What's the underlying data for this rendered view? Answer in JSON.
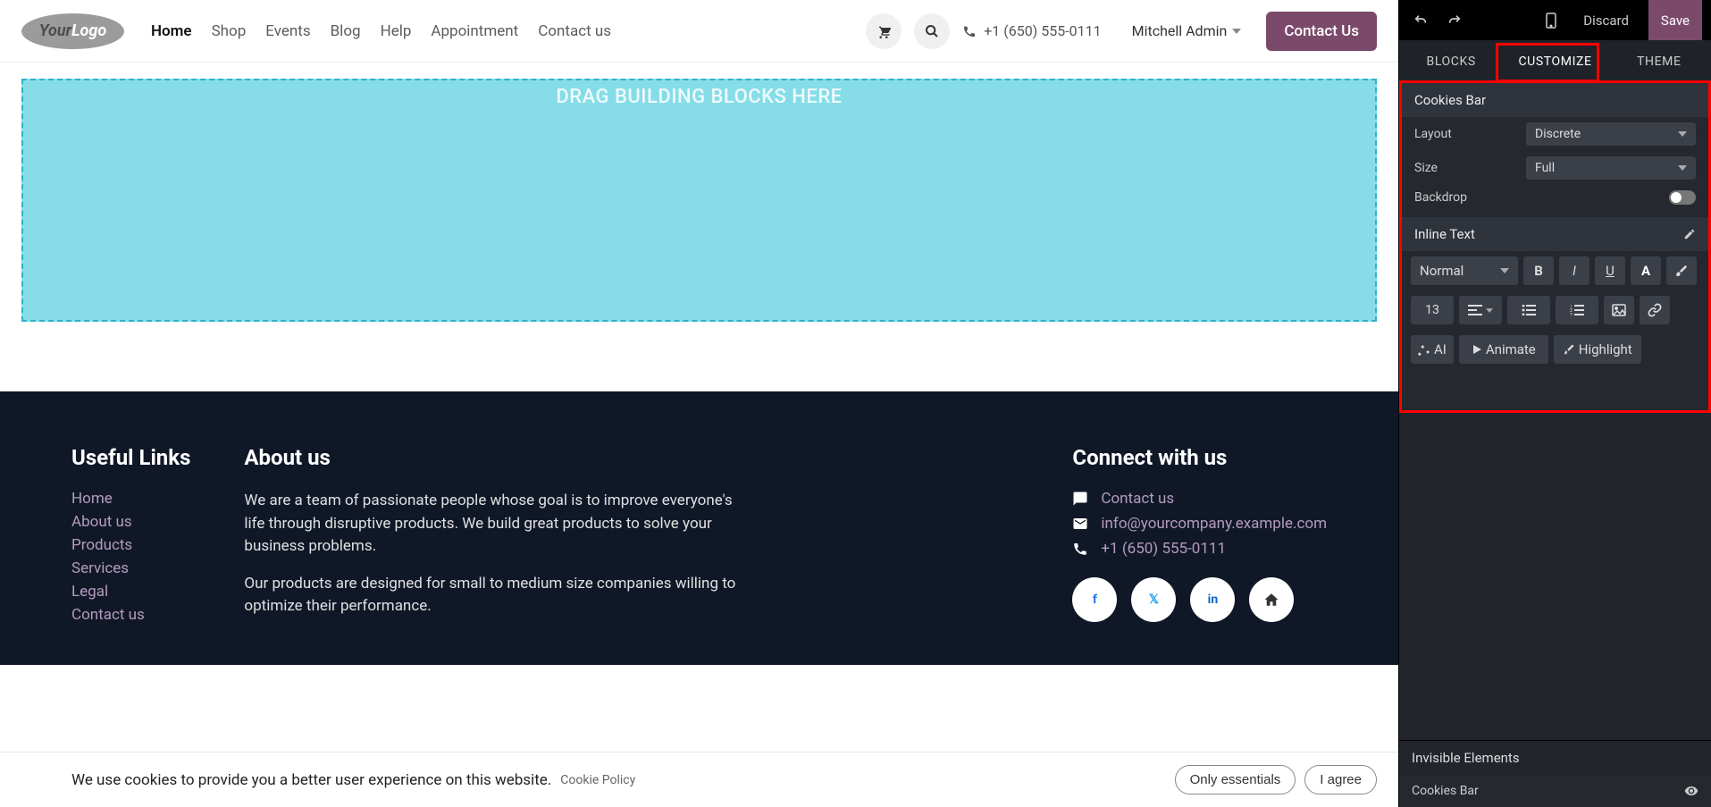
{
  "header": {
    "nav": [
      "Home",
      "Shop",
      "Events",
      "Blog",
      "Help",
      "Appointment",
      "Contact us"
    ],
    "active_nav": 0,
    "phone": "+1 (650) 555-0111",
    "admin": "Mitchell Admin",
    "contact_btn": "Contact Us"
  },
  "dropzone_text": "DRAG BUILDING BLOCKS HERE",
  "footer": {
    "useful_links_title": "Useful Links",
    "useful_links": [
      "Home",
      "About us",
      "Products",
      "Services",
      "Legal",
      "Contact us"
    ],
    "about_title": "About us",
    "about_p1": "We are a team of passionate people whose goal is to improve everyone's life through disruptive products. We build great products to solve your business problems.",
    "about_p2": "Our products are designed for small to medium size companies willing to optimize their performance.",
    "connect_title": "Connect with us",
    "contact_link": "Contact us",
    "email": "info@yourcompany.example.com",
    "phone": "+1 (650) 555-0111"
  },
  "cookies": {
    "text": "We use cookies to provide you a better user experience on this website.",
    "policy": "Cookie Policy",
    "only_essentials": "Only essentials",
    "agree": "I agree"
  },
  "sidebar": {
    "discard": "Discard",
    "save": "Save",
    "tabs": [
      "BLOCKS",
      "CUSTOMIZE",
      "THEME"
    ],
    "section1_title": "Cookies Bar",
    "layout_label": "Layout",
    "layout_value": "Discrete",
    "size_label": "Size",
    "size_value": "Full",
    "backdrop_label": "Backdrop",
    "section2_title": "Inline Text",
    "text_style": "Normal",
    "font_size": "13",
    "ai_btn": "AI",
    "animate_btn": "Animate",
    "highlight_btn": "Highlight",
    "invisible_title": "Invisible Elements",
    "invisible_item": "Cookies Bar"
  }
}
